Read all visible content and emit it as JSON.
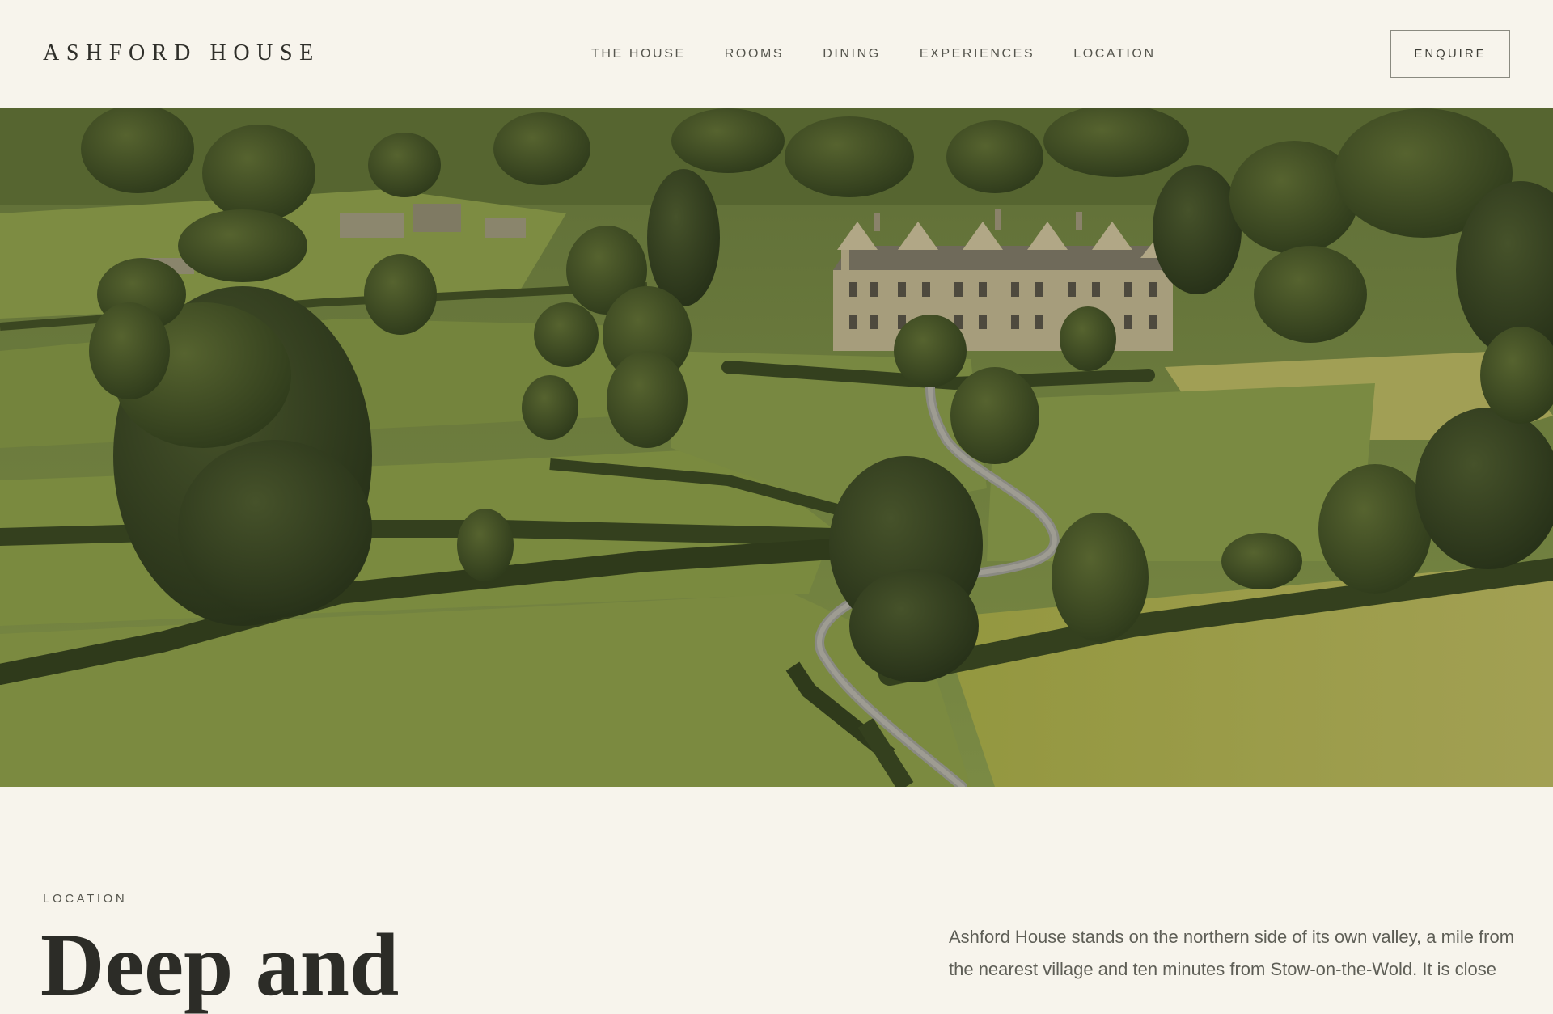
{
  "header": {
    "logo": "ASHFORD HOUSE",
    "nav": [
      {
        "label": "THE HOUSE"
      },
      {
        "label": "ROOMS"
      },
      {
        "label": "DINING"
      },
      {
        "label": "EXPERIENCES"
      },
      {
        "label": "LOCATION"
      }
    ],
    "cta_label": "ENQUIRE"
  },
  "hero": {
    "image_subject": "aerial view of a stone manor house surrounded by green fields, hedgerows and trees"
  },
  "intro": {
    "eyebrow": "LOCATION",
    "heading": "Deep and",
    "body": "Ashford House stands on the northern side of its own valley, a mile from the nearest village and ten minutes from Stow-on-the-Wold. It is close"
  },
  "colors": {
    "background": "#f7f4ec",
    "text": "#3a3a34",
    "field_green": "#7f8d45",
    "hedge_green": "#3f4a26"
  }
}
